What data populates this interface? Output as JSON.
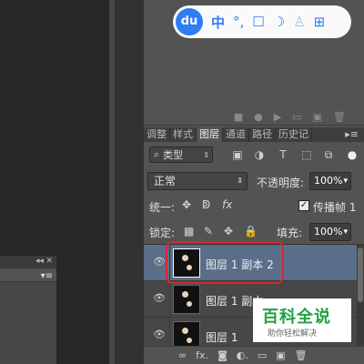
{
  "baidu_toolbar": {
    "logo": "du",
    "items": [
      "中",
      "°,",
      "☐",
      "☽",
      "♙",
      "⊞"
    ],
    "icons": [
      "chinese-input-icon",
      "punctuation-icon",
      "skin-icon",
      "night-mode-icon",
      "user-icon",
      "grid-menu-icon"
    ]
  },
  "side_panel": {
    "collapse": "◂◂",
    "close": "✕",
    "menu": "▾≡"
  },
  "panel_icons": [
    "■",
    "●",
    "▶",
    "▭",
    "▣",
    "🗑"
  ],
  "tabs": [
    {
      "label": "调整",
      "active": false
    },
    {
      "label": "样式",
      "active": false
    },
    {
      "label": "图层",
      "active": true
    },
    {
      "label": "通道",
      "active": false
    },
    {
      "label": "路径",
      "active": false
    },
    {
      "label": "历史记",
      "active": false
    }
  ],
  "tab_menu": "▸≡",
  "filter": {
    "icon": "⌕",
    "label": "类型",
    "arrow": "⇕"
  },
  "blend": {
    "mode": "正常",
    "arrow": "⇕",
    "opacity_label": "不透明度:",
    "opacity_value": "100%",
    "opacity_arrow": "▾"
  },
  "unify": {
    "label": "统一:",
    "propagate_label": "传播帧 1",
    "propagate_checked": "✓"
  },
  "lock": {
    "label": "锁定:",
    "fill_label": "填充:",
    "fill_value": "100%",
    "fill_arrow": "▾"
  },
  "layers": [
    {
      "name": "图层 1 副本 2",
      "selected": true
    },
    {
      "name": "图层 1 副本",
      "selected": false
    },
    {
      "name": "图层 1",
      "selected": false
    }
  ],
  "eye": "👁",
  "bottom_icons": [
    "∞",
    "fx.",
    "◙",
    "◐.",
    "▭",
    "▣",
    "🗑"
  ],
  "baike": {
    "title": "百科全说",
    "subtitle": "助你轻松解决"
  },
  "colors": {
    "highlight": "#d9262b",
    "selected_layer": "#5b6e89",
    "baidu_blue": "#2e7cf6",
    "baike_green": "#21a142"
  }
}
